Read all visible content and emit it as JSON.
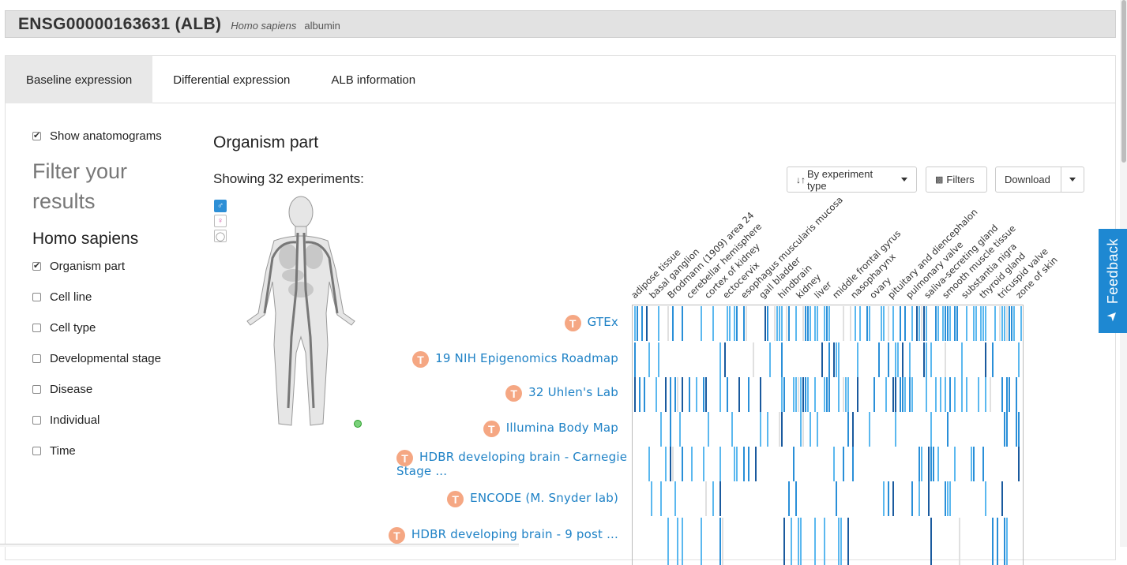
{
  "header": {
    "gene": "ENSG00000163631 (ALB)",
    "species": "Homo sapiens",
    "description": "albumin"
  },
  "tabs": [
    {
      "label": "Baseline expression",
      "active": true
    },
    {
      "label": "Differential expression",
      "active": false
    },
    {
      "label": "ALB information",
      "active": false
    }
  ],
  "sidebar": {
    "show_anatomograms": "Show anatomograms",
    "filter_title": "Filter your results",
    "species_heading": "Homo sapiens",
    "filters": [
      {
        "label": "Organism part",
        "checked": true
      },
      {
        "label": "Cell line",
        "checked": false
      },
      {
        "label": "Cell type",
        "checked": false
      },
      {
        "label": "Developmental stage",
        "checked": false
      },
      {
        "label": "Disease",
        "checked": false
      },
      {
        "label": "Individual",
        "checked": false
      },
      {
        "label": "Time",
        "checked": false
      }
    ]
  },
  "main": {
    "section_title": "Organism part",
    "showing": "Showing 32 experiments:",
    "sort_button": "By experiment type",
    "filters_button": "Filters",
    "download_button": "Download"
  },
  "sex_icons": [
    "male-icon",
    "female-icon",
    "brain-icon"
  ],
  "experiments": [
    {
      "badge": "T",
      "label": "GTEx"
    },
    {
      "badge": "T",
      "label": "19 NIH Epigenomics Roadmap"
    },
    {
      "badge": "T",
      "label": "32 Uhlen's Lab"
    },
    {
      "badge": "T",
      "label": "Illumina Body Map"
    },
    {
      "badge": "T",
      "label": "HDBR developing brain - Carnegie",
      "label2": "Stage ..."
    },
    {
      "badge": "T",
      "label": "ENCODE (M. Snyder lab)"
    },
    {
      "badge": "T",
      "label": "HDBR developing brain - 9 post ..."
    }
  ],
  "column_labels": [
    "adipose tissue",
    "basal ganglion",
    "Brodmann (1909) area 24",
    "cerebellar hemisphere",
    "cortex of kidney",
    "ectocervix",
    "esophagus muscularis mucosa",
    "gall bladder",
    "hindbrain",
    "kidney",
    "liver",
    "middle frontal gyrus",
    "nasopharynx",
    "ovary",
    "pituitary and diencephalon",
    "pulmonary valve",
    "saliva-secreting gland",
    "smooth muscle tissue",
    "substantia nigra",
    "thyroid gland",
    "tricuspid valve",
    "zone of skin"
  ],
  "colors": {
    "link": "#1f82c6",
    "badge": "#f5a783",
    "heat_light": "#5bb8ef",
    "heat_mid": "#2a8fd8",
    "heat_dark": "#1a5a9e",
    "heat_faint": "#e0e0e0",
    "feedback": "#1e88d2"
  },
  "feedback": "Feedback"
}
